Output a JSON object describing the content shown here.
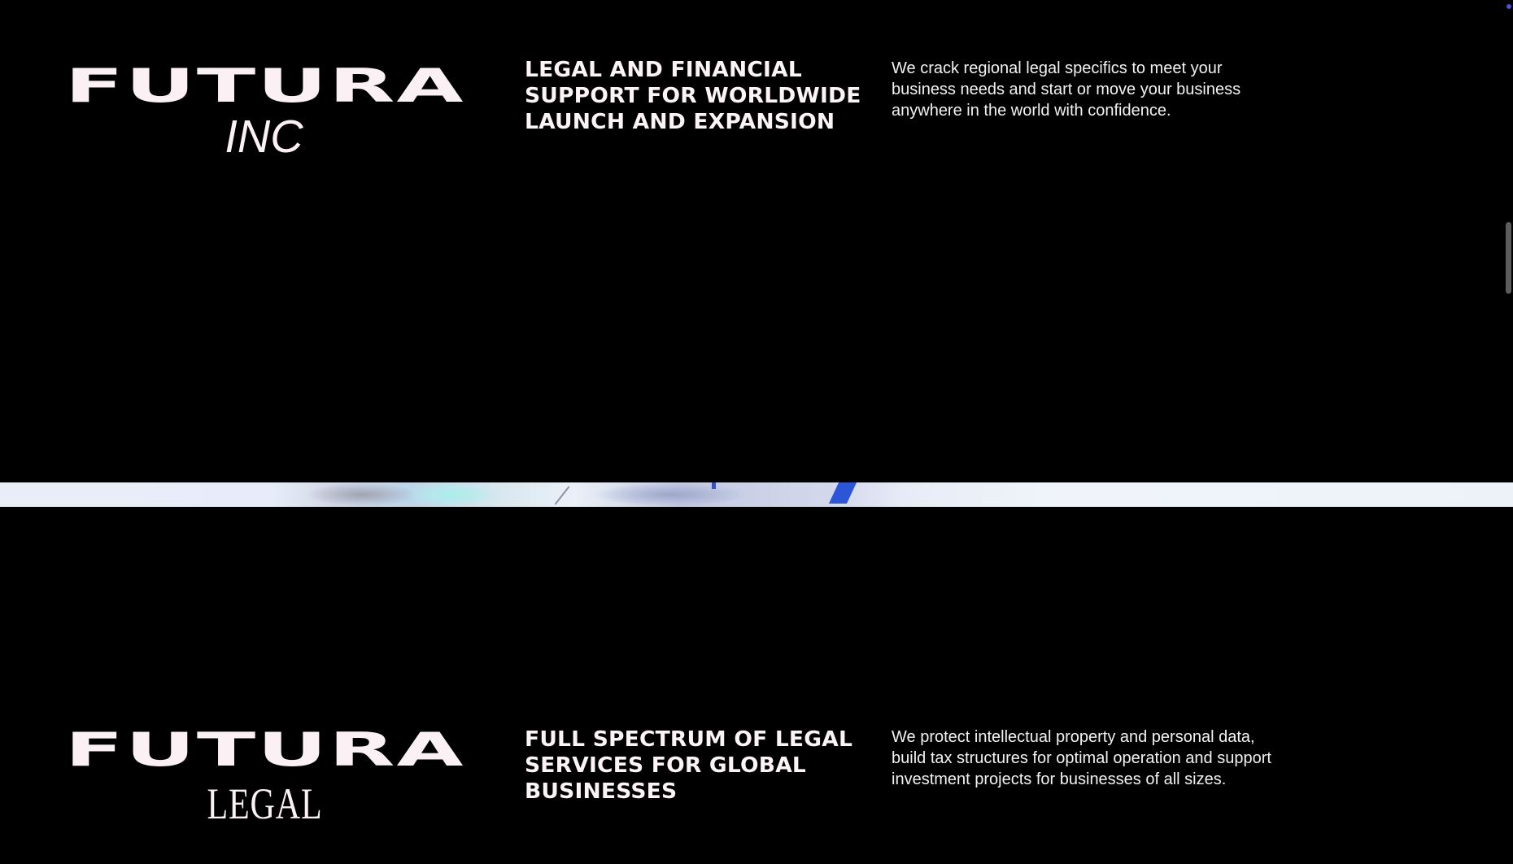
{
  "sections": [
    {
      "logo": {
        "word": "FUTURA",
        "sub": "INC"
      },
      "heading": "LEGAL AND FINANCIAL SUPPORT FOR WORLDWIDE LAUNCH AND EXPANSION",
      "description": "We crack regional legal specifics to meet your business needs and start or move your business anywhere in the world with confidence."
    },
    {
      "logo": {
        "word": "FUTURA",
        "sub": "LEGAL"
      },
      "heading": "FULL SPECTRUM OF LEGAL SERVICES FOR GLOBAL BUSINESSES",
      "description": "We protect intellectual property and personal data, build tax structures for optimal operation and support investment projects for businesses of all sizes."
    }
  ],
  "colors": {
    "background": "#000000",
    "text": "#fbf1f4",
    "accent_blue": "#2d55d8"
  },
  "icons": [
    "scroll-indicator-dot"
  ]
}
